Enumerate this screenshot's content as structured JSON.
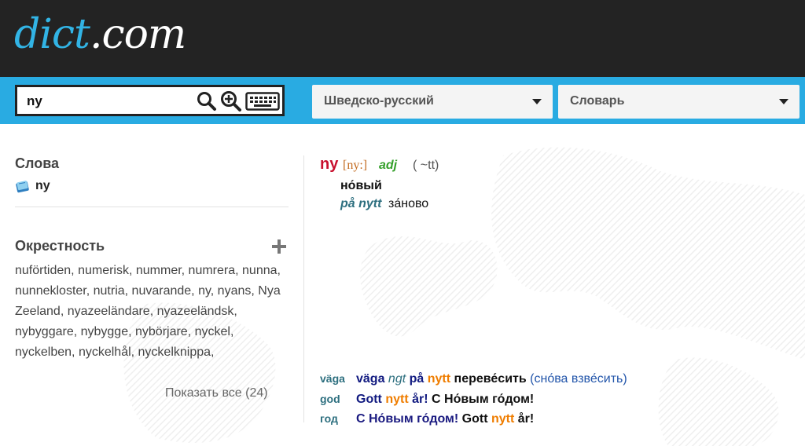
{
  "header": {
    "logo_part1": "dict",
    "logo_part2": ".com"
  },
  "search": {
    "value": "ny",
    "placeholder": "",
    "search_icon": "search-icon",
    "zoom_icon": "zoom-in-icon",
    "keyboard_icon": "keyboard-icon"
  },
  "selects": {
    "language": "Шведско-русский",
    "type": "Словарь"
  },
  "sidebar": {
    "words_title": "Слова",
    "word": "ny",
    "nearby_title": "Окрестность",
    "nearby_items": [
      "nuförtiden",
      "numerisk",
      "nummer",
      "numrera",
      "nunna",
      "nunnekloster",
      "nutria",
      "nuvarande",
      "ny",
      "nyans",
      "Nya Zeeland",
      "nyazeeländare",
      "nyazeeländsk",
      "nybyggare",
      "nybygge",
      "nybörjare",
      "nyckel",
      "nyckelben",
      "nyckelhål",
      "nyckelknippa"
    ],
    "show_all": "Показать все (24)"
  },
  "entry": {
    "headword": "ny",
    "transcription": "[ny:]",
    "pos": "adj",
    "inflection": "( ~tt)",
    "translation": "но́вый",
    "example_sv": "på nytt",
    "example_ru": "за́ново"
  },
  "examples": [
    {
      "key": "väga",
      "parts": [
        {
          "t": "väga",
          "c": "sv"
        },
        {
          "t": " "
        },
        {
          "t": "ngt",
          "c": "it"
        },
        {
          "t": " "
        },
        {
          "t": "på",
          "c": "sv"
        },
        {
          "t": " "
        },
        {
          "t": "nytt",
          "c": "hl"
        },
        {
          "t": " "
        },
        {
          "t": "переве́сить",
          "c": "ru-b"
        },
        {
          "t": " "
        },
        {
          "t": "(сно́ва взве́сить)",
          "c": "gl"
        }
      ]
    },
    {
      "key": "god",
      "parts": [
        {
          "t": "Gott",
          "c": "sv"
        },
        {
          "t": " "
        },
        {
          "t": "nytt",
          "c": "hl"
        },
        {
          "t": " "
        },
        {
          "t": "år!",
          "c": "sv"
        },
        {
          "t": " "
        },
        {
          "t": "С Но́вым го́дом!",
          "c": "ru-b"
        }
      ]
    },
    {
      "key": "год",
      "parts": [
        {
          "t": "С Но́вым го́дом!",
          "c": "ru-bb"
        },
        {
          "t": " "
        },
        {
          "t": "Gott",
          "c": "ru-b"
        },
        {
          "t": " "
        },
        {
          "t": "nytt",
          "c": "hl"
        },
        {
          "t": " "
        },
        {
          "t": "år!",
          "c": "ru-b"
        }
      ]
    }
  ]
}
